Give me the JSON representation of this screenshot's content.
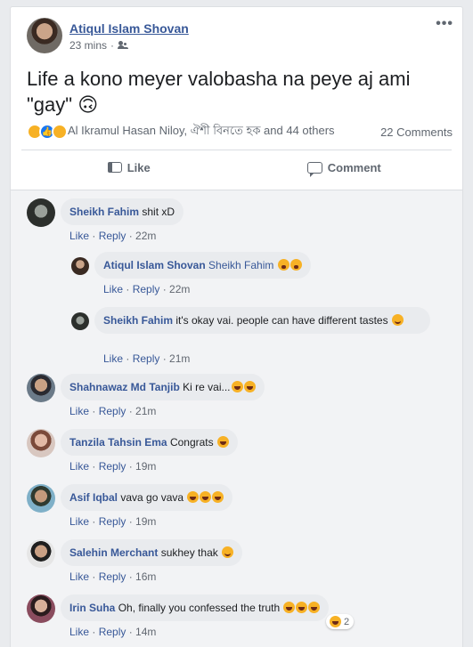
{
  "post": {
    "author": "Atiqul Islam Shovan",
    "time": "23 mins",
    "dot": "·",
    "more_icon": "•••",
    "text": "Life a kono meyer valobasha na peye aj ami \"gay\" 🙃",
    "reactions_text": "Al Ikramul Hasan Niloy, ঐশী বিনতে হক and 44 others",
    "comments_count": "22 Comments"
  },
  "actions": {
    "like": "Like",
    "comment": "Comment"
  },
  "comment_actions": {
    "like": "Like",
    "reply": "Reply",
    "dot": " · "
  },
  "comments": [
    {
      "name": "Sheikh Fahim",
      "text": "shit xD",
      "time": "22m"
    },
    {
      "name": "Atiqul Islam Shovan",
      "text": "Sheikh Fahim",
      "time": "22m"
    },
    {
      "name": "Sheikh Fahim",
      "text": "it's okay vai. people can have different tastes",
      "time": "21m"
    },
    {
      "name": "Shahnawaz Md Tanjib",
      "text": "Ki re vai...",
      "time": "21m"
    },
    {
      "name": "Tanzila Tahsin Ema",
      "text": "Congrats",
      "time": "19m"
    },
    {
      "name": "Asif Iqbal",
      "text": "vava go vava",
      "time": "19m"
    },
    {
      "name": "Salehin Merchant",
      "text": "sukhey thak",
      "time": "16m"
    },
    {
      "name": "Irin Suha",
      "text": "Oh, finally you confessed the truth",
      "time": "14m",
      "reaction_count": "2"
    }
  ],
  "colors": {
    "link": "#385898",
    "bubble": "#e9ebee",
    "background": "#e9ebee",
    "accent": "#1877f2"
  }
}
